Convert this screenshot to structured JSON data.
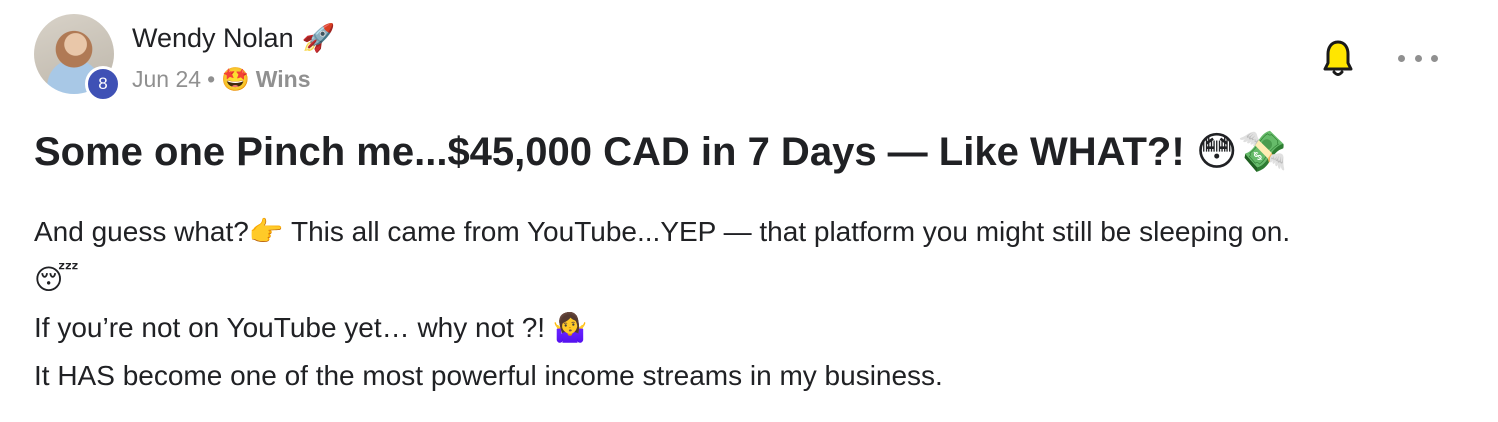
{
  "post": {
    "author": {
      "name": "Wendy Nolan",
      "badge_emoji": "🚀",
      "level": "8"
    },
    "date": "Jun 24",
    "separator": "•",
    "category": {
      "emoji": "🤩",
      "label": "Wins"
    },
    "title": "Some one Pinch me...$45,000 CAD in 7 Days — Like WHAT?!",
    "title_emoji": "😳💸",
    "lines": [
      {
        "text": "And guess what?",
        "emoji": "👉",
        "rest": " This all came from YouTube...YEP — that platform you might still be sleeping on."
      },
      {
        "text": "",
        "emoji": "😴",
        "rest": ""
      },
      {
        "text": "If you’re not on YouTube yet… why not ?! ",
        "emoji": "🤷‍♀️",
        "rest": ""
      },
      {
        "text": "It HAS become one of the most powerful income streams in my business.",
        "emoji": "",
        "rest": ""
      }
    ]
  },
  "icons": {
    "bell": "bell-icon",
    "more": "more-options-icon"
  },
  "colors": {
    "level_badge": "#3f51b5",
    "meta_text": "#909090",
    "bell_yellow": "#ffe600"
  }
}
